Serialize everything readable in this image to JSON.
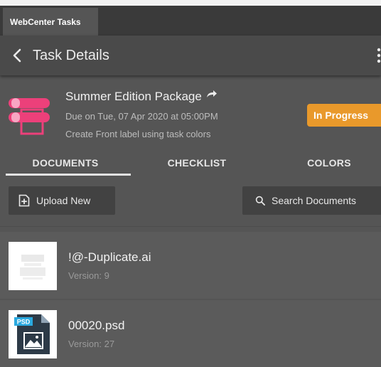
{
  "app": {
    "tab_label": "WebCenter Tasks"
  },
  "header": {
    "title": "Task Details"
  },
  "task": {
    "name": "Summer Edition Package",
    "due": "Due on Tue, 07 Apr 2020 at 05:00PM",
    "description": "Create Front label using task colors",
    "status": "In Progress",
    "status_color": "#e9992b",
    "icon_color": "#ec407a"
  },
  "tabs": [
    {
      "label": "DOCUMENTS",
      "selected": true
    },
    {
      "label": "CHECKLIST",
      "selected": false
    },
    {
      "label": "COLORS",
      "selected": false
    }
  ],
  "actions": {
    "upload_label": "Upload New",
    "search_label": "Search Documents"
  },
  "documents": [
    {
      "name": "!@-Duplicate.ai",
      "version": "Version: 9",
      "thumbnail": "document-preview"
    },
    {
      "name": "00020.psd",
      "version": "Version: 27",
      "thumbnail": "psd-file-icon"
    }
  ]
}
